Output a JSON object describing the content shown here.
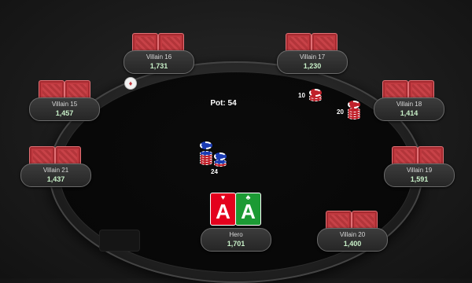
{
  "pot_label": "Pot: 54",
  "dealer_button_symbol": "♦",
  "colors": {
    "card_back": "#c0393f",
    "stack_green": "#c8f0c8",
    "hero_heart_card": "#e4001d",
    "hero_club_card": "#1c9a34",
    "chip_red": "#c0202a",
    "chip_blue": "#1b3cb3"
  },
  "players": [
    {
      "name": "Villain 16",
      "stack": "1,731"
    },
    {
      "name": "Villain 17",
      "stack": "1,230"
    },
    {
      "name": "Villain 15",
      "stack": "1,457"
    },
    {
      "name": "Villain 18",
      "stack": "1,414"
    },
    {
      "name": "Villain 21",
      "stack": "1,437"
    },
    {
      "name": "Villain 19",
      "stack": "1,591"
    },
    {
      "name": "Hero",
      "stack": "1,701"
    },
    {
      "name": "Villain 20",
      "stack": "1,400"
    }
  ],
  "hero_cards": [
    {
      "rank": "A",
      "suit": "♥",
      "color": "#e4001d"
    },
    {
      "rank": "A",
      "suit": "♣",
      "color": "#1c9a34"
    }
  ],
  "bets": [
    {
      "label": "10",
      "chip": "red"
    },
    {
      "label": "20",
      "chip": "red"
    },
    {
      "label": "24",
      "chip": "blue"
    }
  ]
}
